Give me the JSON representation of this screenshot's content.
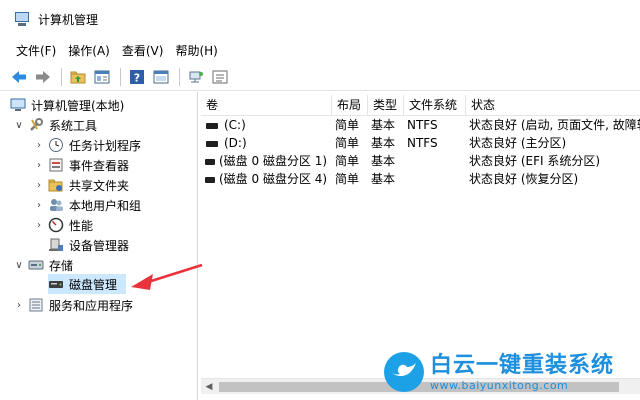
{
  "window": {
    "title": "计算机管理"
  },
  "menu": [
    "文件(F)",
    "操作(A)",
    "查看(V)",
    "帮助(H)"
  ],
  "toolbar": {
    "buttons": [
      "back-icon",
      "forward-icon",
      "up-folder-icon",
      "show-hide-tree-icon",
      "help-icon",
      "properties-icon",
      "connect-icon",
      "list-view-icon"
    ]
  },
  "tree": {
    "root": "计算机管理(本地)",
    "system_tools": "系统工具",
    "task_scheduler": "任务计划程序",
    "event_viewer": "事件查看器",
    "shared_folders": "共享文件夹",
    "local_users": "本地用户和组",
    "performance": "性能",
    "device_manager": "设备管理器",
    "storage": "存储",
    "disk_management": "磁盘管理",
    "services_apps": "服务和应用程序"
  },
  "table": {
    "columns": [
      "卷",
      "布局",
      "类型",
      "文件系统",
      "状态"
    ],
    "rows": [
      {
        "volume": "(C:)",
        "layout": "简单",
        "type": "基本",
        "fs": "NTFS",
        "status": "状态良好 (启动, 页面文件, 故障转"
      },
      {
        "volume": "(D:)",
        "layout": "简单",
        "type": "基本",
        "fs": "NTFS",
        "status": "状态良好 (主分区)"
      },
      {
        "volume": "(磁盘 0 磁盘分区 1)",
        "layout": "简单",
        "type": "基本",
        "fs": "",
        "status": "状态良好 (EFI 系统分区)"
      },
      {
        "volume": "(磁盘 0 磁盘分区 4)",
        "layout": "简单",
        "type": "基本",
        "fs": "",
        "status": "状态良好 (恢复分区)"
      }
    ]
  },
  "watermark": {
    "title": "白云一键重装系统",
    "url": "www.baiyunxitong.com"
  },
  "colors": {
    "selection": "#cce8ff",
    "arrow": "#e8323c",
    "watermark": "#1d8fdc"
  }
}
